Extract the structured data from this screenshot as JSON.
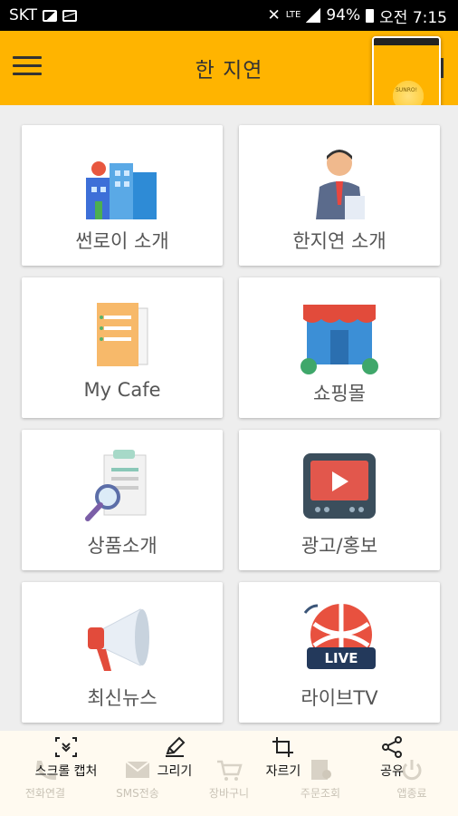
{
  "status_bar": {
    "carrier": "SKT",
    "network": "LTE",
    "battery": "94%",
    "time": "오전 7:15"
  },
  "app": {
    "title": "한 지연"
  },
  "preview": {
    "logo_text": "SUNRO!"
  },
  "grid": [
    {
      "label": "썬로이 소개",
      "icon": "buildings-icon"
    },
    {
      "label": "한지연 소개",
      "icon": "businessman-icon"
    },
    {
      "label": "My Cafe",
      "icon": "folder-documents-icon"
    },
    {
      "label": "쇼핑몰",
      "icon": "storefront-icon"
    },
    {
      "label": "상품소개",
      "icon": "document-search-icon"
    },
    {
      "label": "광고/홍보",
      "icon": "tv-play-icon"
    },
    {
      "label": "최신뉴스",
      "icon": "megaphone-icon"
    },
    {
      "label": "라이브TV",
      "icon": "live-globe-icon"
    }
  ],
  "bottom_nav": [
    {
      "label": "전화연결",
      "icon": "phone-icon"
    },
    {
      "label": "SMS전송",
      "icon": "mail-icon"
    },
    {
      "label": "장바구니",
      "icon": "cart-icon"
    },
    {
      "label": "주문조회",
      "icon": "order-icon"
    },
    {
      "label": "앱종료",
      "icon": "power-icon"
    }
  ],
  "capture_toolbar": [
    {
      "label": "스크롤 캡처",
      "icon": "scroll-capture-icon"
    },
    {
      "label": "그리기",
      "icon": "pencil-icon"
    },
    {
      "label": "자르기",
      "icon": "crop-icon"
    },
    {
      "label": "공유",
      "icon": "share-icon"
    }
  ],
  "colors": {
    "accent": "#FFB400",
    "background": "#eeeeee"
  }
}
